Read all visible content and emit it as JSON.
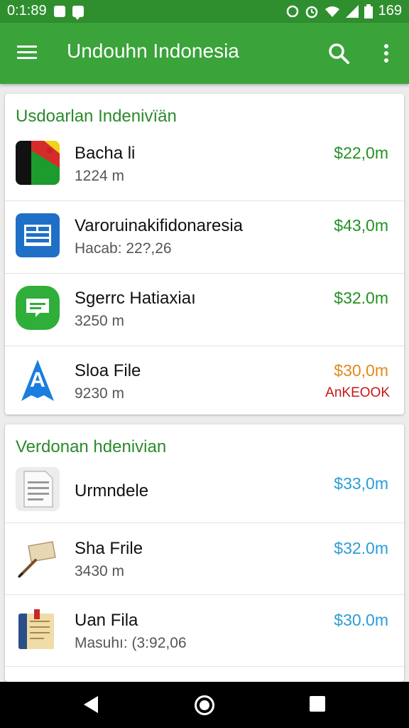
{
  "status_bar": {
    "time": "0:1:89",
    "battery_text": "169"
  },
  "app_bar": {
    "title": "Undouhn Indonesia"
  },
  "sections": [
    {
      "title": "Usdoarlan Indenivïän",
      "items": [
        {
          "name": "Bacha li",
          "sub": "1224 m",
          "price": "$22,0m",
          "price_color": "#239123",
          "tag": "",
          "icon": "flag-icon"
        },
        {
          "name": "Varoruinakifidonaresia",
          "sub": "Hacab: 22?,26",
          "price": "$43,0m",
          "price_color": "#239123",
          "tag": "",
          "icon": "document-grid-icon"
        },
        {
          "name": "Sgerrc Hatiaxiaı",
          "sub": "3250 m",
          "price": "$32.0m",
          "price_color": "#239123",
          "tag": "",
          "icon": "message-icon"
        },
        {
          "name": "Sloa File",
          "sub": "9230 m",
          "price": "$30,0m",
          "price_color": "#e08a1e",
          "tag": "AnKEOOK",
          "icon": "letter-a-icon"
        }
      ]
    },
    {
      "title": "Verdonan hdenivian",
      "items": [
        {
          "name": "Urmndele",
          "sub": "",
          "price": "$33,0m",
          "price_color": "#2a9ed6",
          "tag": "",
          "icon": "text-document-icon"
        },
        {
          "name": "Sha Frile",
          "sub": "3430 m",
          "price": "$32.0m",
          "price_color": "#2a9ed6",
          "tag": "",
          "icon": "scroll-quill-icon"
        },
        {
          "name": "Uan Fila",
          "sub": "Masuhı: (3:92,06",
          "price": "$30.0m",
          "price_color": "#2a9ed6",
          "tag": "",
          "icon": "notebook-icon"
        }
      ]
    }
  ]
}
